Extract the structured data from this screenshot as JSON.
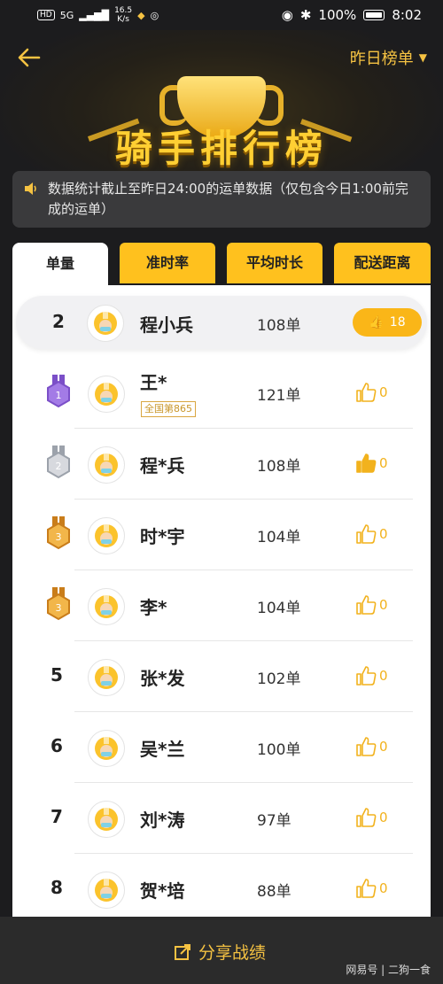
{
  "status_bar": {
    "network": "HD",
    "signal": "5G",
    "speed_value": "16.5",
    "speed_unit": "K/s",
    "battery": "100%",
    "time": "8:02"
  },
  "header": {
    "back_icon": "arrow-left-icon",
    "period_label": "昨日榜单",
    "title": "骑手排行榜"
  },
  "notice": {
    "icon": "speaker-icon",
    "text": "数据统计截止至昨日24:00的运单数据（仅包含今日1:00前完成的运单）"
  },
  "tabs": [
    {
      "label": "单量",
      "active": true
    },
    {
      "label": "准时率",
      "active": false
    },
    {
      "label": "平均时长",
      "active": false
    },
    {
      "label": "配送距离",
      "active": false
    }
  ],
  "self_row": {
    "rank": "2",
    "name": "程小兵",
    "orders": "108单",
    "likes": "18"
  },
  "rows": [
    {
      "rank": "1",
      "medal": "purple",
      "name": "王*",
      "badge": "全国第865",
      "orders": "121单",
      "likes": "0",
      "liked": false
    },
    {
      "rank": "2",
      "medal": "silver",
      "name": "程*兵",
      "orders": "108单",
      "likes": "0",
      "liked": true
    },
    {
      "rank": "3",
      "medal": "bronze",
      "name": "时*宇",
      "orders": "104单",
      "likes": "0",
      "liked": false
    },
    {
      "rank": "3",
      "medal": "bronze",
      "name": "李*",
      "orders": "104单",
      "likes": "0",
      "liked": false
    },
    {
      "rank": "5",
      "medal": "",
      "name": "张*发",
      "orders": "102单",
      "likes": "0",
      "liked": false
    },
    {
      "rank": "6",
      "medal": "",
      "name": "吴*兰",
      "orders": "100单",
      "likes": "0",
      "liked": false
    },
    {
      "rank": "7",
      "medal": "",
      "name": "刘*涛",
      "orders": "97单",
      "likes": "0",
      "liked": false
    },
    {
      "rank": "8",
      "medal": "",
      "name": "贺*培",
      "orders": "88单",
      "likes": "0",
      "liked": false
    }
  ],
  "share": {
    "label": "分享战绩",
    "icon": "share-icon"
  },
  "watermark": "网易号 | 二狗一食",
  "colors": {
    "accent": "#f5c242",
    "tab_yellow": "#ffc11e",
    "like_orange": "#fab618",
    "background": "#1c1c1e"
  }
}
